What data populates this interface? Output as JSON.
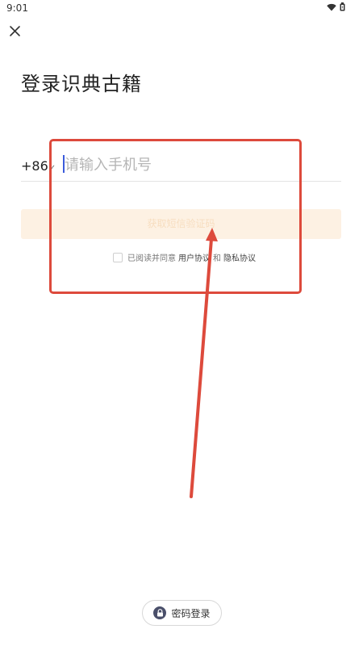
{
  "status_bar": {
    "time": "9:01"
  },
  "header": {
    "title": "登录识典古籍"
  },
  "phone": {
    "country_code": "+86",
    "placeholder": "请输入手机号",
    "value": ""
  },
  "send_code": {
    "label": "获取短信验证码"
  },
  "agreement": {
    "prefix": "已阅读并同意",
    "user_agreement": "用户协议",
    "and": "和",
    "privacy_policy": "隐私协议",
    "checked": false
  },
  "password_login": {
    "label": "密码登录",
    "icon": "lock-icon"
  },
  "annotation": {
    "box_color": "#dd4a3c",
    "arrow_color": "#dd4a3c"
  },
  "colors": {
    "accent": "#f5a25d",
    "cursor": "#3b5bdb"
  }
}
